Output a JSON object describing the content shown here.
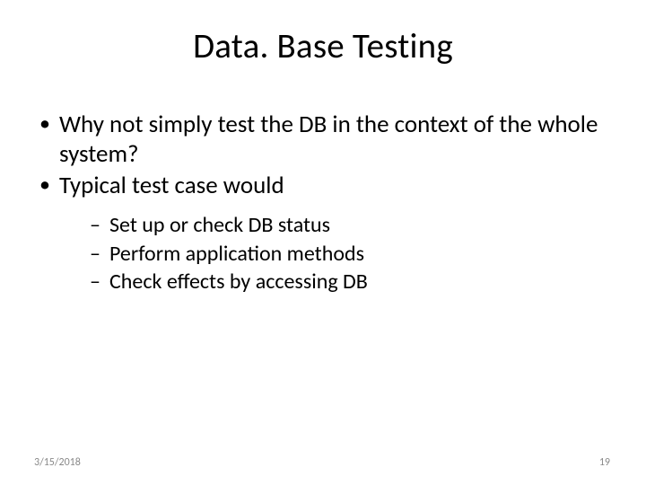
{
  "title": "Data. Base Testing",
  "bullets": [
    "Why not simply test the DB in the context of the whole system?",
    "Typical test case would"
  ],
  "sub_bullets": [
    "Set up or check DB status",
    "Perform application methods",
    "Check effects by accessing DB"
  ],
  "footer": {
    "date": "3/15/2018",
    "page": "19"
  }
}
